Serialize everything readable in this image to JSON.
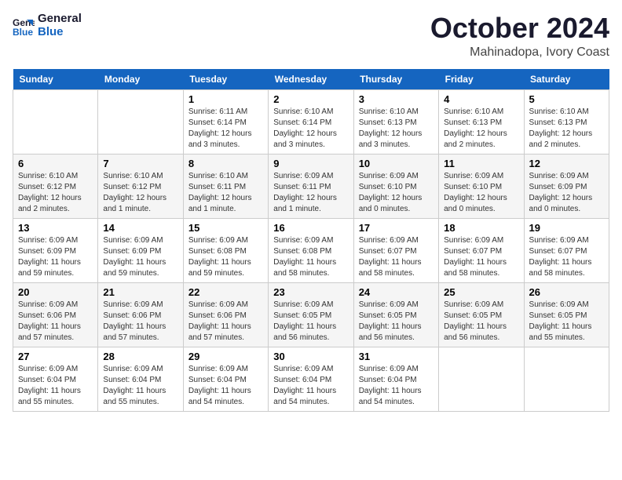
{
  "logo": {
    "line1": "General",
    "line2": "Blue"
  },
  "title": "October 2024",
  "location": "Mahinadopa, Ivory Coast",
  "days_of_week": [
    "Sunday",
    "Monday",
    "Tuesday",
    "Wednesday",
    "Thursday",
    "Friday",
    "Saturday"
  ],
  "weeks": [
    [
      {
        "day": "",
        "info": ""
      },
      {
        "day": "",
        "info": ""
      },
      {
        "day": "1",
        "info": "Sunrise: 6:11 AM\nSunset: 6:14 PM\nDaylight: 12 hours and 3 minutes."
      },
      {
        "day": "2",
        "info": "Sunrise: 6:10 AM\nSunset: 6:14 PM\nDaylight: 12 hours and 3 minutes."
      },
      {
        "day": "3",
        "info": "Sunrise: 6:10 AM\nSunset: 6:13 PM\nDaylight: 12 hours and 3 minutes."
      },
      {
        "day": "4",
        "info": "Sunrise: 6:10 AM\nSunset: 6:13 PM\nDaylight: 12 hours and 2 minutes."
      },
      {
        "day": "5",
        "info": "Sunrise: 6:10 AM\nSunset: 6:13 PM\nDaylight: 12 hours and 2 minutes."
      }
    ],
    [
      {
        "day": "6",
        "info": "Sunrise: 6:10 AM\nSunset: 6:12 PM\nDaylight: 12 hours and 2 minutes."
      },
      {
        "day": "7",
        "info": "Sunrise: 6:10 AM\nSunset: 6:12 PM\nDaylight: 12 hours and 1 minute."
      },
      {
        "day": "8",
        "info": "Sunrise: 6:10 AM\nSunset: 6:11 PM\nDaylight: 12 hours and 1 minute."
      },
      {
        "day": "9",
        "info": "Sunrise: 6:09 AM\nSunset: 6:11 PM\nDaylight: 12 hours and 1 minute."
      },
      {
        "day": "10",
        "info": "Sunrise: 6:09 AM\nSunset: 6:10 PM\nDaylight: 12 hours and 0 minutes."
      },
      {
        "day": "11",
        "info": "Sunrise: 6:09 AM\nSunset: 6:10 PM\nDaylight: 12 hours and 0 minutes."
      },
      {
        "day": "12",
        "info": "Sunrise: 6:09 AM\nSunset: 6:09 PM\nDaylight: 12 hours and 0 minutes."
      }
    ],
    [
      {
        "day": "13",
        "info": "Sunrise: 6:09 AM\nSunset: 6:09 PM\nDaylight: 11 hours and 59 minutes."
      },
      {
        "day": "14",
        "info": "Sunrise: 6:09 AM\nSunset: 6:09 PM\nDaylight: 11 hours and 59 minutes."
      },
      {
        "day": "15",
        "info": "Sunrise: 6:09 AM\nSunset: 6:08 PM\nDaylight: 11 hours and 59 minutes."
      },
      {
        "day": "16",
        "info": "Sunrise: 6:09 AM\nSunset: 6:08 PM\nDaylight: 11 hours and 58 minutes."
      },
      {
        "day": "17",
        "info": "Sunrise: 6:09 AM\nSunset: 6:07 PM\nDaylight: 11 hours and 58 minutes."
      },
      {
        "day": "18",
        "info": "Sunrise: 6:09 AM\nSunset: 6:07 PM\nDaylight: 11 hours and 58 minutes."
      },
      {
        "day": "19",
        "info": "Sunrise: 6:09 AM\nSunset: 6:07 PM\nDaylight: 11 hours and 58 minutes."
      }
    ],
    [
      {
        "day": "20",
        "info": "Sunrise: 6:09 AM\nSunset: 6:06 PM\nDaylight: 11 hours and 57 minutes."
      },
      {
        "day": "21",
        "info": "Sunrise: 6:09 AM\nSunset: 6:06 PM\nDaylight: 11 hours and 57 minutes."
      },
      {
        "day": "22",
        "info": "Sunrise: 6:09 AM\nSunset: 6:06 PM\nDaylight: 11 hours and 57 minutes."
      },
      {
        "day": "23",
        "info": "Sunrise: 6:09 AM\nSunset: 6:05 PM\nDaylight: 11 hours and 56 minutes."
      },
      {
        "day": "24",
        "info": "Sunrise: 6:09 AM\nSunset: 6:05 PM\nDaylight: 11 hours and 56 minutes."
      },
      {
        "day": "25",
        "info": "Sunrise: 6:09 AM\nSunset: 6:05 PM\nDaylight: 11 hours and 56 minutes."
      },
      {
        "day": "26",
        "info": "Sunrise: 6:09 AM\nSunset: 6:05 PM\nDaylight: 11 hours and 55 minutes."
      }
    ],
    [
      {
        "day": "27",
        "info": "Sunrise: 6:09 AM\nSunset: 6:04 PM\nDaylight: 11 hours and 55 minutes."
      },
      {
        "day": "28",
        "info": "Sunrise: 6:09 AM\nSunset: 6:04 PM\nDaylight: 11 hours and 55 minutes."
      },
      {
        "day": "29",
        "info": "Sunrise: 6:09 AM\nSunset: 6:04 PM\nDaylight: 11 hours and 54 minutes."
      },
      {
        "day": "30",
        "info": "Sunrise: 6:09 AM\nSunset: 6:04 PM\nDaylight: 11 hours and 54 minutes."
      },
      {
        "day": "31",
        "info": "Sunrise: 6:09 AM\nSunset: 6:04 PM\nDaylight: 11 hours and 54 minutes."
      },
      {
        "day": "",
        "info": ""
      },
      {
        "day": "",
        "info": ""
      }
    ]
  ]
}
